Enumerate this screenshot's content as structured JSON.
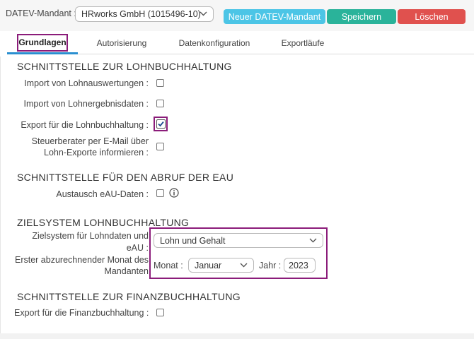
{
  "header": {
    "mandant_label": "DATEV-Mandant :",
    "mandant_value": "HRworks GmbH (1015496-10)",
    "new_button": "Neuer DATEV-Mandant",
    "save_button": "Speichern",
    "delete_button": "Löschen"
  },
  "tabs": [
    {
      "label": "Grundlagen"
    },
    {
      "label": "Autorisierung"
    },
    {
      "label": "Datenkonfiguration"
    },
    {
      "label": "Exportläufe"
    }
  ],
  "sections": {
    "lohn": {
      "title": "SCHNITTSTELLE ZUR LOHNBUCHHALTUNG",
      "import_auswertungen": "Import von Lohnauswertungen :",
      "import_ergebnisse": "Import von Lohnergebnisdaten :",
      "export_lohn": "Export für die Lohnbuchhaltung :",
      "steuer_line1": "Steuerberater per E-Mail über",
      "steuer_line2": "Lohn-Exporte informieren :"
    },
    "eau": {
      "title": "SCHNITTSTELLE FÜR DEN ABRUF DER EAU",
      "austausch": "Austausch eAU-Daten :"
    },
    "ziel": {
      "title": "ZIELSYSTEM LOHNBUCHHALTUNG",
      "zielsystem_line1": "Zielsystem für Lohndaten und",
      "zielsystem_line2": "eAU :",
      "zielsystem_value": "Lohn und Gehalt",
      "erster_line1": "Erster abzurechnender Monat des",
      "erster_line2": "Mandanten",
      "monat_label": "Monat :",
      "monat_value": "Januar",
      "jahr_label": "Jahr :",
      "jahr_value": "2023"
    },
    "fibu": {
      "title": "SCHNITTSTELLE ZUR FINANZBUCHHALTUNG",
      "export_fibu": "Export für die Finanzbuchhaltung :"
    }
  },
  "checkboxes": {
    "import_auswertungen": false,
    "import_ergebnisse": false,
    "export_lohn": true,
    "steuer": false,
    "austausch": false,
    "export_fibu": false
  },
  "colors": {
    "new_button": "#4cc5e6",
    "save_button": "#2ab39a",
    "delete_button": "#e0514e",
    "highlight": "#8b1c7a"
  },
  "icons": {
    "info": "info-circle-icon",
    "dropdown": "chevron-down-icon",
    "check": "check-icon"
  }
}
